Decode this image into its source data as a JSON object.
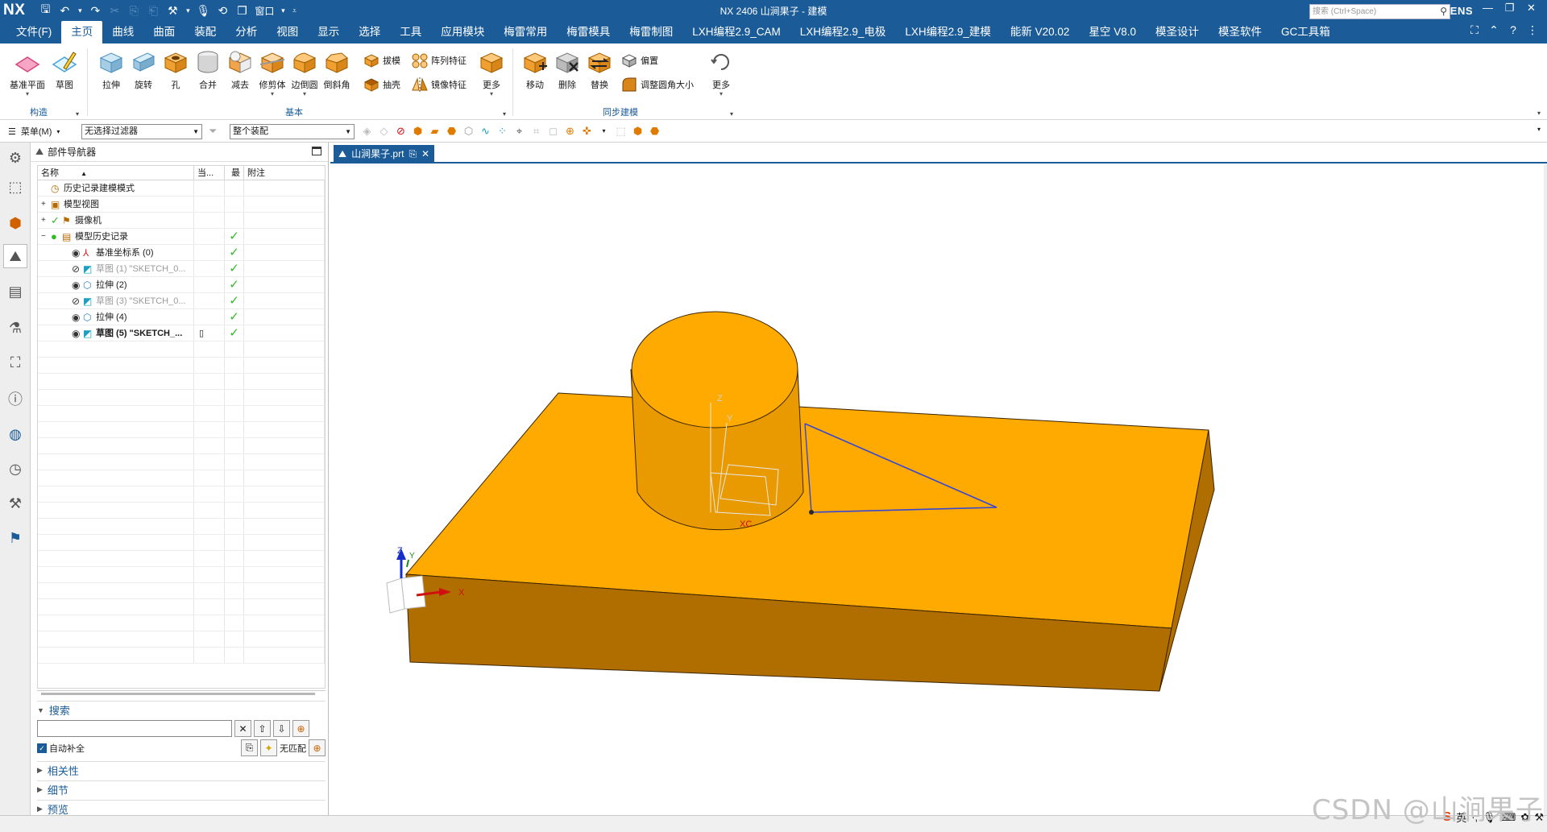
{
  "app": {
    "logo": "NX",
    "window_title": "NX 2406 山涧果子 - 建模",
    "brand": "SIEMENS",
    "window_menu": "窗口"
  },
  "menu_tabs": [
    "文件(F)",
    "主页",
    "曲线",
    "曲面",
    "装配",
    "分析",
    "视图",
    "显示",
    "选择",
    "工具",
    "应用模块",
    "梅雷常用",
    "梅雷模具",
    "梅雷制图",
    "LXH编程2.9_CAM",
    "LXH编程2.9_电极",
    "LXH编程2.9_建模",
    "能新 V20.02",
    "星空 V8.0",
    "模圣设计",
    "模圣软件",
    "GC工具箱"
  ],
  "active_tab": "主页",
  "search": {
    "placeholder": "搜索 (Ctrl+Space)"
  },
  "ribbon": {
    "construct": {
      "label": "构造",
      "buttons": [
        "基准平面",
        "草图"
      ]
    },
    "basic": {
      "label": "基本",
      "buttons": [
        "拉伸",
        "旋转",
        "孔",
        "合并",
        "减去",
        "修剪体",
        "边倒圆",
        "倒斜角"
      ],
      "small": [
        "拔模",
        "阵列特征",
        "抽壳",
        "镜像特征"
      ],
      "more": "更多"
    },
    "sync": {
      "label": "同步建模",
      "buttons": [
        "移动",
        "删除",
        "替换"
      ],
      "small": [
        "偏置",
        "调整圆角大小"
      ],
      "more": "更多"
    }
  },
  "toolbar2": {
    "menu": "菜单(M)",
    "filter": "无选择过滤器",
    "scope": "整个装配"
  },
  "navigator": {
    "title": "部件导航器",
    "columns": [
      "名称",
      "当...",
      "最",
      "附注"
    ],
    "rows": [
      {
        "name": "历史记录建模模式",
        "style": "normal",
        "check": false
      },
      {
        "name": "模型视图",
        "style": "normal",
        "check": false
      },
      {
        "name": "摄像机",
        "style": "normal",
        "check": false
      },
      {
        "name": "模型历史记录",
        "style": "normal",
        "check": true
      },
      {
        "name": "基准坐标系 (0)",
        "style": "normal",
        "check": true
      },
      {
        "name": "草图 (1) \"SKETCH_0...",
        "style": "grey",
        "check": true
      },
      {
        "name": "拉伸 (2)",
        "style": "normal",
        "check": true
      },
      {
        "name": "草图 (3) \"SKETCH_0...",
        "style": "grey",
        "check": true
      },
      {
        "name": "拉伸 (4)",
        "style": "normal",
        "check": true
      },
      {
        "name": "草图 (5) \"SKETCH_...",
        "style": "bold",
        "check": true
      }
    ]
  },
  "search_panel": {
    "title": "搜索",
    "auto_complete": "自动补全",
    "no_match": "无匹配",
    "sections": [
      "相关性",
      "细节",
      "预览"
    ]
  },
  "graphics": {
    "tab": "山涧果子.prt",
    "labels": {
      "csys_z": "Z",
      "csys_y": "Y",
      "csys_x": "X",
      "sketch_xc": "XC",
      "sketch_z": "Z",
      "sketch_y": "Y"
    },
    "colors": {
      "face_top": "#ffaa00",
      "face_side": "#b06d00",
      "face_front": "#e89a00",
      "sketch_line": "#3546d6"
    }
  },
  "status": {
    "ime": "英",
    "watermark": "CSDN @山涧果子"
  }
}
